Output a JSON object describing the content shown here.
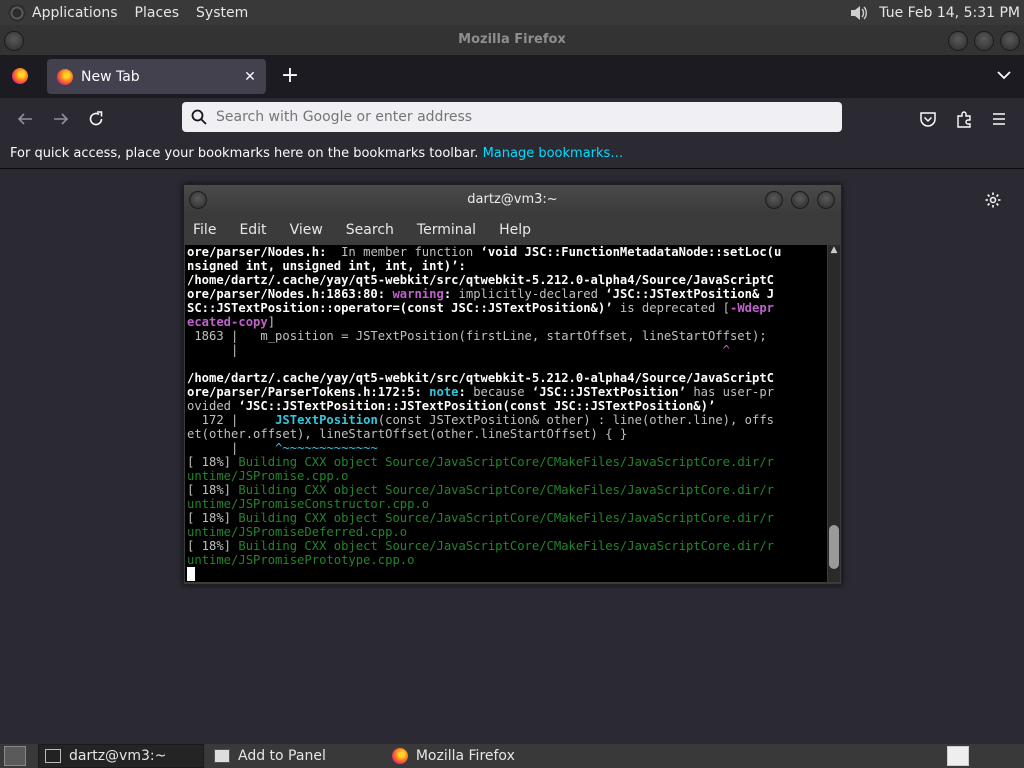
{
  "top_panel": {
    "menus": [
      "Applications",
      "Places",
      "System"
    ],
    "clock": "Tue Feb 14,  5:31 PM"
  },
  "firefox": {
    "title": "Mozilla Firefox",
    "tab_label": "New Tab",
    "new_tab_symbol": "+",
    "tab_close_symbol": "✕",
    "search_placeholder": "Search with Google or enter address",
    "bookmarks_text": "For quick access, place your bookmarks here on the bookmarks toolbar.",
    "bookmarks_link": "Manage bookmarks…"
  },
  "terminal": {
    "title": "dartz@vm3:~",
    "menus": [
      "File",
      "Edit",
      "View",
      "Search",
      "Terminal",
      "Help"
    ],
    "lines": [
      [
        [
          "b",
          "ore/parser/Nodes.h:"
        ],
        [
          "",
          "  In member function "
        ],
        [
          "b",
          "‘void JSC::FunctionMetadataNode::setLoc(u"
        ]
      ],
      [
        [
          "b",
          "nsigned int, unsigned int, int, int)’:"
        ]
      ],
      [
        [
          "b",
          "/home/dartz/.cache/yay/qt5-webkit/src/qtwebkit-5.212.0-alpha4/Source/JavaScriptC"
        ]
      ],
      [
        [
          "b",
          "ore/parser/Nodes.h:1863:80: "
        ],
        [
          "w",
          "warning"
        ],
        [
          "b",
          ": "
        ],
        [
          "",
          "implicitly-declared "
        ],
        [
          "b",
          "‘JSC::JSTextPosition& J"
        ]
      ],
      [
        [
          "b",
          "SC::JSTextPosition::operator=(const JSC::JSTextPosition&)’"
        ],
        [
          "",
          " is deprecated ["
        ],
        [
          "w",
          "-Wdepr"
        ]
      ],
      [
        [
          "w",
          "ecated-copy"
        ],
        [
          "",
          "]"
        ]
      ],
      [
        [
          "",
          " 1863 |   m_position = JSTextPosition(firstLine, startOffset, lineStartOffset);"
        ]
      ],
      [
        [
          "",
          "      |                                                                  "
        ],
        [
          "wn",
          "^"
        ]
      ],
      [
        [
          "",
          ""
        ]
      ],
      [
        [
          "b",
          "/home/dartz/.cache/yay/qt5-webkit/src/qtwebkit-5.212.0-alpha4/Source/JavaScriptC"
        ]
      ],
      [
        [
          "b",
          "ore/parser/ParserTokens.h:172:5: "
        ],
        [
          "nt",
          "note"
        ],
        [
          "b",
          ": "
        ],
        [
          "",
          "because "
        ],
        [
          "b",
          "‘JSC::JSTextPosition’"
        ],
        [
          "",
          " has user-pr"
        ]
      ],
      [
        [
          "",
          "ovided "
        ],
        [
          "b",
          "‘JSC::JSTextPosition::JSTextPosition(const JSC::JSTextPosition&)’"
        ]
      ],
      [
        [
          "",
          "  172 |     "
        ],
        [
          "nt",
          "JSTextPosition"
        ],
        [
          "",
          "(const JSTextPosition& other) : line(other.line), offs"
        ]
      ],
      [
        [
          "",
          "et(other.offset), lineStartOffset(other.lineStartOffset) { }"
        ]
      ],
      [
        [
          "",
          "      |     "
        ],
        [
          "cu",
          "^~~~~~~~~~~~~~"
        ]
      ],
      [
        [
          "",
          "[ 18%] "
        ],
        [
          "g",
          "Building CXX object Source/JavaScriptCore/CMakeFiles/JavaScriptCore.dir/r"
        ]
      ],
      [
        [
          "g",
          "untime/JSPromise.cpp.o"
        ]
      ],
      [
        [
          "",
          "[ 18%] "
        ],
        [
          "g",
          "Building CXX object Source/JavaScriptCore/CMakeFiles/JavaScriptCore.dir/r"
        ]
      ],
      [
        [
          "g",
          "untime/JSPromiseConstructor.cpp.o"
        ]
      ],
      [
        [
          "",
          "[ 18%] "
        ],
        [
          "g",
          "Building CXX object Source/JavaScriptCore/CMakeFiles/JavaScriptCore.dir/r"
        ]
      ],
      [
        [
          "g",
          "untime/JSPromiseDeferred.cpp.o"
        ]
      ],
      [
        [
          "",
          "[ 18%] "
        ],
        [
          "g",
          "Building CXX object Source/JavaScriptCore/CMakeFiles/JavaScriptCore.dir/r"
        ]
      ],
      [
        [
          "g",
          "untime/JSPromisePrototype.cpp.o"
        ]
      ]
    ]
  },
  "taskbar": {
    "items": [
      "dartz@vm3:~",
      "Add to Panel",
      "Mozilla Firefox"
    ]
  }
}
